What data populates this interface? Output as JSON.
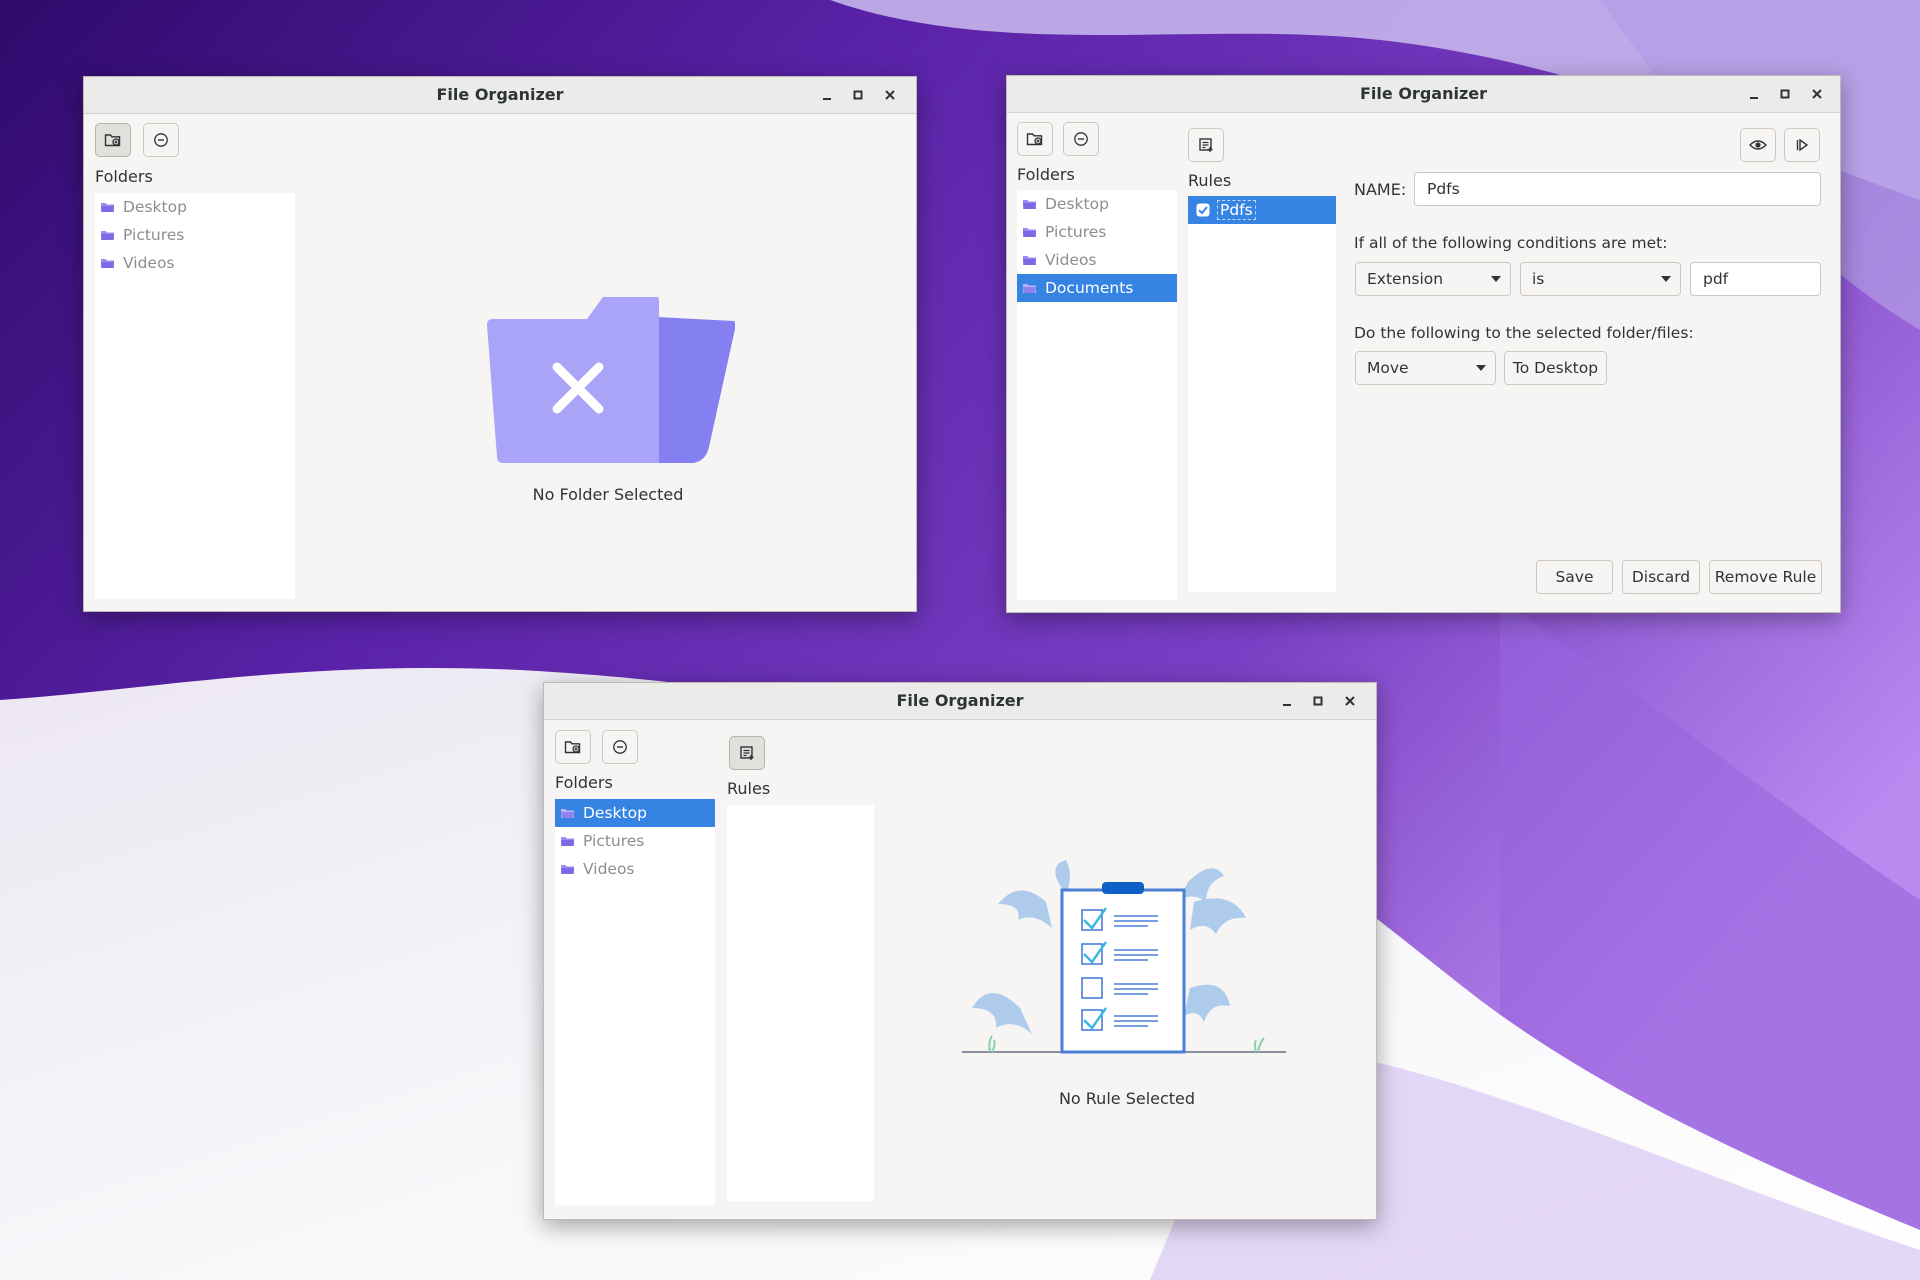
{
  "app": {
    "title": "File Organizer"
  },
  "toolbar": {
    "add_folder_icon": "folder-add-icon",
    "remove_folder_icon": "remove-circle-icon",
    "add_rule_icon": "add-rule-icon",
    "preview_icon": "eye-icon",
    "run_icon": "play-icon"
  },
  "colors": {
    "selection": "#3584e4",
    "folder_icon": "#9b8cf2",
    "illustration_folder": "#a9a4f7"
  },
  "window1": {
    "title": "File Organizer",
    "folders_label": "Folders",
    "folders": [
      "Desktop",
      "Pictures",
      "Videos"
    ],
    "empty_message": "No Folder Selected"
  },
  "window2": {
    "title": "File Organizer",
    "folders_label": "Folders",
    "folders": [
      "Desktop",
      "Pictures",
      "Videos",
      "Documents"
    ],
    "selected_folder": "Documents",
    "rules_label": "Rules",
    "rules": [
      "Pdfs"
    ],
    "rule_checked": true,
    "name_label": "NAME:",
    "name_value": "Pdfs",
    "conditions_label": "If all of the following conditions are met:",
    "condition_field": "Extension",
    "condition_operator": "is",
    "condition_value": "pdf",
    "actions_label": "Do the following to the selected folder/files:",
    "action": "Move",
    "action_target": "To Desktop",
    "save_label": "Save",
    "discard_label": "Discard",
    "remove_rule_label": "Remove Rule"
  },
  "window3": {
    "title": "File Organizer",
    "folders_label": "Folders",
    "folders": [
      "Desktop",
      "Pictures",
      "Videos"
    ],
    "selected_folder": "Desktop",
    "rules_label": "Rules",
    "empty_message": "No Rule Selected"
  }
}
